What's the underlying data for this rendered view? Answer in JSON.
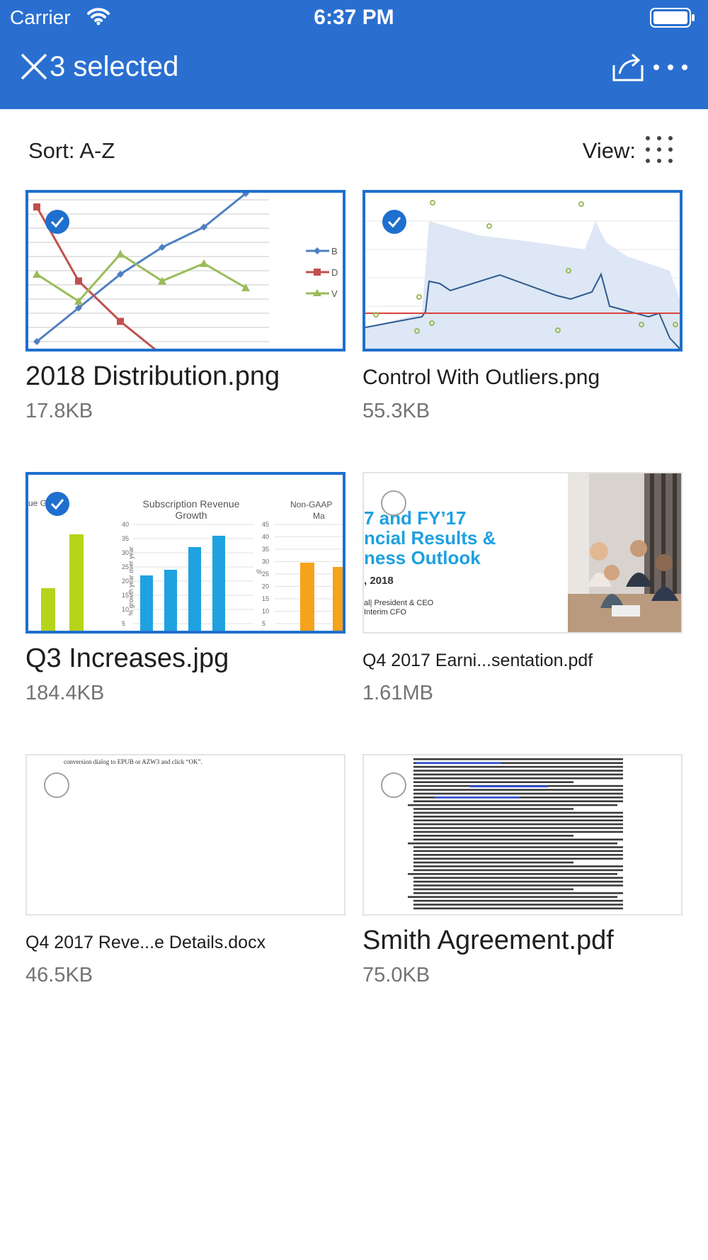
{
  "status_bar": {
    "carrier": "Carrier",
    "time": "6:37 PM"
  },
  "header": {
    "title": "3 selected",
    "close_icon": "close-icon",
    "share_icon": "share-icon",
    "more_icon": "more-icon"
  },
  "toolbar": {
    "sort_label": "Sort: A-Z",
    "view_label": "View:",
    "view_icon": "grid-view-icon"
  },
  "colors": {
    "accent": "#2a6fd0",
    "selection": "#1f6fcf"
  },
  "files": [
    {
      "name": "2018 Distribution.png",
      "size": "17.8KB",
      "selected": true
    },
    {
      "name": "Control With Outliers.png",
      "size": "55.3KB",
      "selected": true
    },
    {
      "name": "Q3 Increases.jpg",
      "size": "184.4KB",
      "selected": true
    },
    {
      "name": "Q4 2017 Earni...sentation.pdf",
      "size": "1.61MB",
      "selected": false
    },
    {
      "name": "Q4 2017 Reve...e Details.docx",
      "size": "46.5KB",
      "selected": false
    },
    {
      "name": "Smith Agreement.pdf",
      "size": "75.0KB",
      "selected": false
    }
  ],
  "thumbnails": {
    "q3_chart_title": "Subscription Revenue Growth",
    "q3_chart_title_line1": "Subscription Revenue",
    "q3_chart_title_line2": "Growth",
    "q3_left_fragment": "ue G",
    "q3_right_fragment_1": "Non-GAAP",
    "q3_right_fragment_2": "Ma",
    "q3_ylabel": "% growth year over year",
    "q3_yticks": [
      "40",
      "35",
      "30",
      "25",
      "20",
      "15",
      "10",
      "5"
    ],
    "q3_right_yticks": [
      "45",
      "40",
      "35",
      "30",
      "25",
      "20",
      "15",
      "10",
      "5"
    ],
    "q3_right_axis_symbol": "%",
    "pdf_line1": "7 and FY’17",
    "pdf_line2": "ncial Results &",
    "pdf_line3": "ness Outlook",
    "pdf_line4": ", 2018",
    "pdf_line5": "al| President & CEO",
    "pdf_line6": "Interim CFO",
    "docx_text": "conversion dialog to EPUB or AZW3 and click “OK”."
  },
  "chart_data": [
    {
      "type": "line",
      "x": [
        1,
        2,
        3,
        4,
        5,
        6
      ],
      "series": [
        {
          "name": "",
          "values": [
            0,
            2.5,
            5,
            7,
            8.5,
            11
          ]
        },
        {
          "name": "",
          "values": [
            10,
            4.5,
            1.5,
            -1,
            -2.5,
            -3.5
          ]
        },
        {
          "name": "",
          "values": [
            5,
            3,
            6.5,
            4.5,
            5.8,
            4
          ]
        }
      ],
      "ylim": [
        0,
        10
      ],
      "grid": true
    },
    {
      "type": "bar",
      "title": "Subscription Revenue Growth",
      "ylabel": "% growth year over year",
      "categories": [
        "",
        "",
        "",
        ""
      ],
      "values": [
        22,
        24,
        32,
        36
      ],
      "ylim": [
        0,
        40
      ]
    }
  ]
}
